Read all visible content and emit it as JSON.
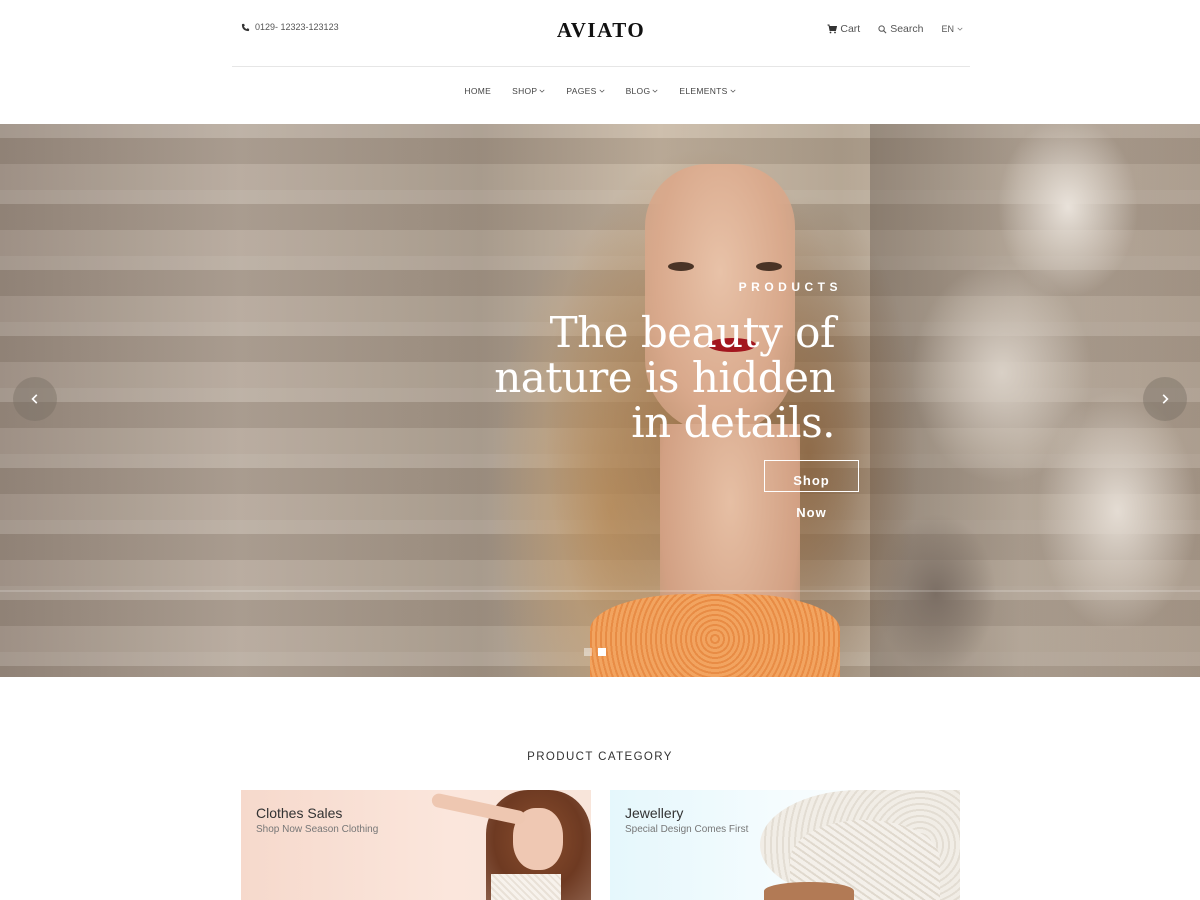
{
  "header": {
    "phone": "0129- 12323-123123",
    "logo": "AVIATO",
    "cart_label": "Cart",
    "search_label": "Search",
    "language": "EN"
  },
  "nav": {
    "items": [
      {
        "label": "HOME",
        "has_dropdown": false
      },
      {
        "label": "SHOP",
        "has_dropdown": true
      },
      {
        "label": "PAGES",
        "has_dropdown": true
      },
      {
        "label": "BLOG",
        "has_dropdown": true
      },
      {
        "label": "ELEMENTS",
        "has_dropdown": true
      }
    ]
  },
  "hero": {
    "kicker": "PRODUCTS",
    "headline": "The beauty of nature is hidden in details.",
    "cta_line1": "Shop",
    "cta_line2": "Now",
    "active_slide": 2,
    "slide_count": 2
  },
  "category": {
    "title": "PRODUCT CATEGORY",
    "cards": [
      {
        "title": "Clothes Sales",
        "subtitle": "Shop Now Season Clothing"
      },
      {
        "title": "Jewellery",
        "subtitle": "Special Design Comes First"
      }
    ]
  },
  "icons": {
    "phone": "phone-icon",
    "cart": "cart-icon",
    "search": "search-icon",
    "chevron": "chevron-down-icon",
    "prev": "chevron-left-icon",
    "next": "chevron-right-icon"
  },
  "colors": {
    "text_dark": "#111111",
    "hero_text": "#ffffff",
    "card1_bg": "#f6d9cc",
    "card2_bg": "#e5f7fc"
  }
}
